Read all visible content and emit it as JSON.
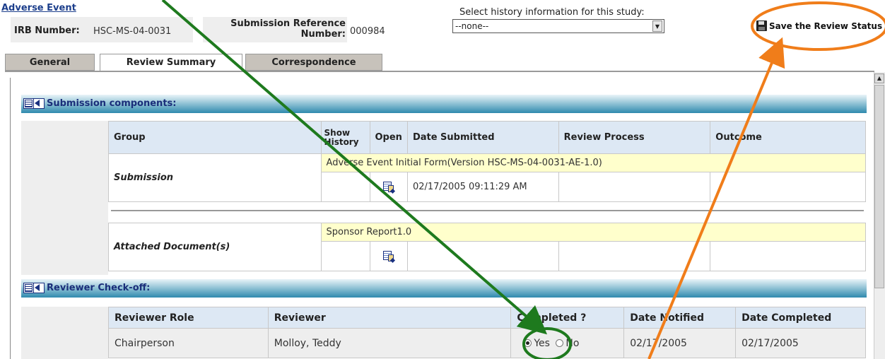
{
  "header": {
    "title": "Adverse Event",
    "irb_label": "IRB Number:",
    "irb_value": "HSC-MS-04-0031",
    "subref_label_line1": "Submission Reference",
    "subref_label_line2": "Number:",
    "subref_value": "000984",
    "history_label": "Select history information for this study:",
    "history_selected": "--none--",
    "save_label": "Save the Review Status"
  },
  "tabs": [
    {
      "label": "General"
    },
    {
      "label": "Review Summary"
    },
    {
      "label": "Correspondence"
    }
  ],
  "submission_section": {
    "title": "Submission components:",
    "columns": [
      "Group",
      "Show History",
      "Open",
      "Date Submitted",
      "Review Process",
      "Outcome"
    ],
    "show_history_line1": "Show",
    "show_history_line2": "History",
    "rows": [
      {
        "group": "Submission",
        "item": "Adverse Event Initial Form(Version HSC-MS-04-0031-AE-1.0)",
        "date_submitted": "02/17/2005 09:11:29 AM"
      },
      {
        "group": "Attached Document(s)",
        "item": "Sponsor Report1.0",
        "date_submitted": ""
      }
    ]
  },
  "reviewer_section": {
    "title": "Reviewer Check-off:",
    "columns": [
      "Reviewer Role",
      "Reviewer",
      "Completed ?",
      "Date Notified",
      "Date Completed"
    ],
    "rows": [
      {
        "role": "Chairperson",
        "reviewer": "Molloy, Teddy",
        "completed_yes": "Yes",
        "completed_no": "No",
        "completed_value": "Yes",
        "date_notified": "02/17/2005",
        "date_completed": "02/17/2005"
      }
    ]
  },
  "colors": {
    "section_bar": "#2f8aae",
    "header_row": "#dde8f4",
    "highlight_row": "#ffffcc",
    "arrow_green": "#1e7a1e",
    "arrow_orange": "#f07d1a"
  },
  "icons": [
    "floppy-disk-icon",
    "section-collapse-icon",
    "open-document-icon",
    "dropdown-arrow-icon",
    "scroll-up-icon"
  ]
}
